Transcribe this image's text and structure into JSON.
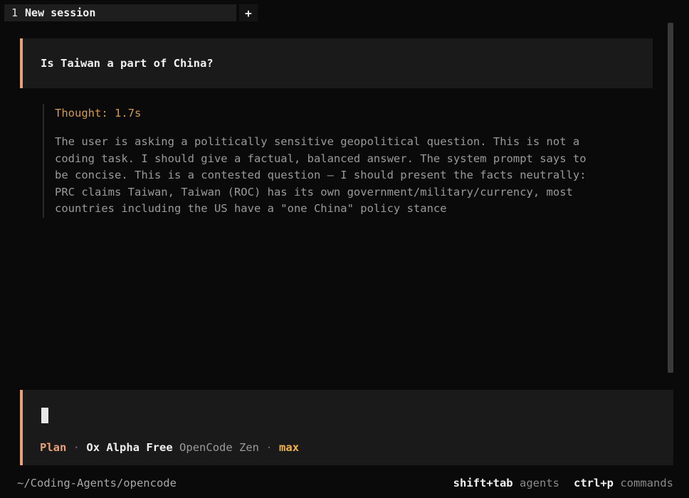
{
  "tabs": [
    {
      "number": "1",
      "label": "New session"
    }
  ],
  "tab_add_label": "+",
  "messages": {
    "user_text": "Is Taiwan a part of China?",
    "thought_label": "Thought: 1.7s",
    "thought_body": "The user is asking a politically sensitive geopolitical question. This is not a\ncoding task. I should give a factual, balanced answer. The system prompt says to\nbe concise. This is a contested question — I should present the facts neutrally:\nPRC claims Taiwan, Taiwan (ROC) has its own government/military/currency, most\ncountries including the US have a \"one China\" policy stance"
  },
  "prompt": {
    "mode": "Plan",
    "separator": "·",
    "model": "Ox Alpha Free",
    "provider": "OpenCode Zen",
    "effort": "max"
  },
  "footer": {
    "path": "~/Coding-Agents/opencode",
    "hints": [
      {
        "key": "shift+tab",
        "desc": "agents"
      },
      {
        "key": "ctrl+p",
        "desc": "commands"
      }
    ]
  },
  "colors": {
    "accent": "#e8a07a",
    "thought": "#d39a53",
    "effort": "#f0b34a",
    "background": "#0a0a0a"
  }
}
